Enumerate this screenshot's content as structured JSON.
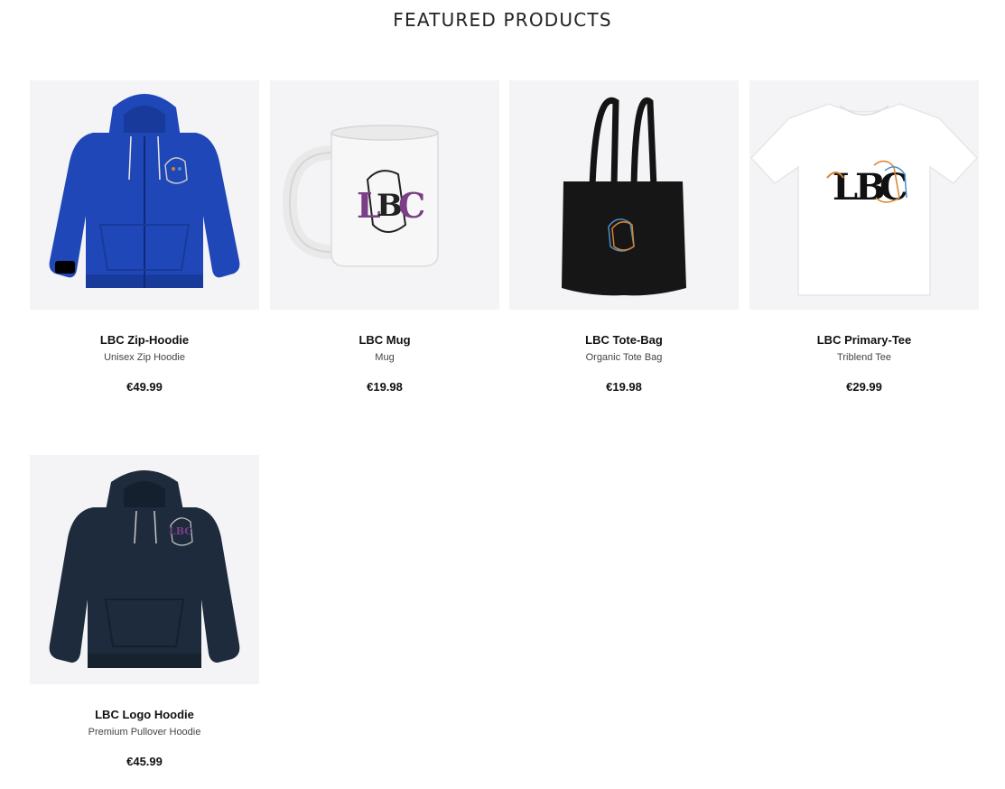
{
  "section": {
    "title": "FEATURED PRODUCTS"
  },
  "products": [
    {
      "name": "LBC Zip-Hoodie",
      "type": "Unisex Zip Hoodie",
      "price": "€49.99",
      "image_icon": "zip-hoodie-icon",
      "color": "#1f47b8"
    },
    {
      "name": "LBC Mug",
      "type": "Mug",
      "price": "€19.98",
      "image_icon": "mug-icon",
      "color": "#f2f2f2"
    },
    {
      "name": "LBC Tote-Bag",
      "type": "Organic Tote Bag",
      "price": "€19.98",
      "image_icon": "tote-bag-icon",
      "color": "#141414"
    },
    {
      "name": "LBC Primary-Tee",
      "type": "Triblend Tee",
      "price": "€29.99",
      "image_icon": "tshirt-icon",
      "color": "#ffffff"
    },
    {
      "name": "LBC Logo Hoodie",
      "type": "Premium Pullover Hoodie",
      "price": "€45.99",
      "image_icon": "hoodie-icon",
      "color": "#1d2b3d"
    }
  ],
  "logo_text": "LBC",
  "colors": {
    "logo_purple": "#7a3f86",
    "logo_orange": "#d9822b",
    "logo_blue": "#4a90c8",
    "image_bg": "#f4f4f6"
  }
}
